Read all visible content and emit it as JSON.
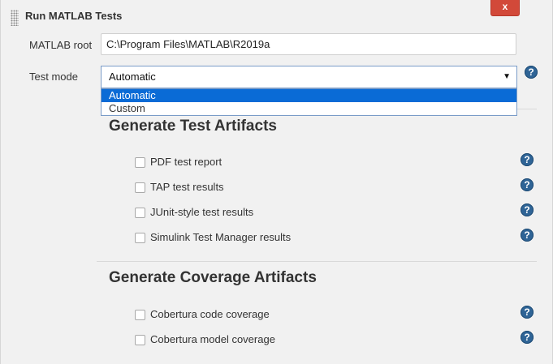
{
  "header": {
    "title": "Run MATLAB Tests",
    "close_label": "x"
  },
  "matlab_root": {
    "label": "MATLAB root",
    "value": "C:\\Program Files\\MATLAB\\R2019a"
  },
  "test_mode": {
    "label": "Test mode",
    "selected": "Automatic",
    "options": [
      "Automatic",
      "Custom"
    ]
  },
  "test_artifacts": {
    "title": "Generate Test Artifacts",
    "items": [
      "PDF test report",
      "TAP test results",
      "JUnit-style test results",
      "Simulink Test Manager results"
    ]
  },
  "coverage_artifacts": {
    "title": "Generate Coverage Artifacts",
    "items": [
      "Cobertura code coverage",
      "Cobertura model coverage"
    ]
  },
  "help_icon_glyph": "?",
  "dropdown_arrow_glyph": "▼",
  "colors": {
    "close_button": "#d24939",
    "selected_option": "#0a6bd6",
    "help_icon": "#2f6496"
  }
}
